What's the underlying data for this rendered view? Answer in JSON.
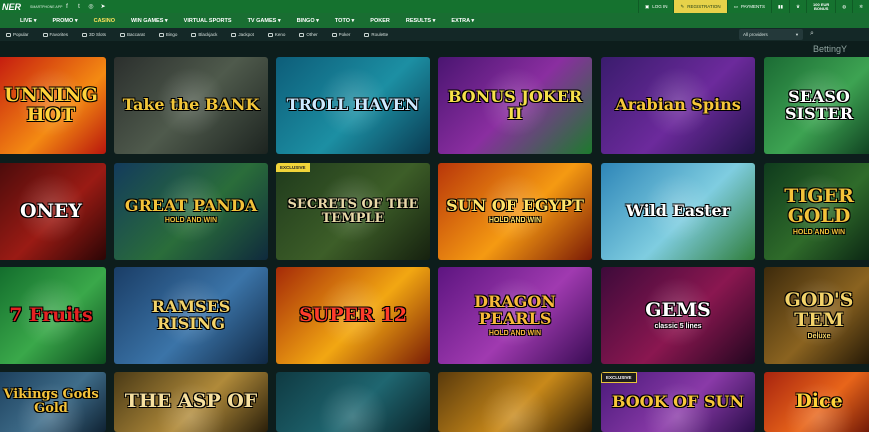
{
  "header": {
    "logo": "NER",
    "app_label": "SMARTPHONE APP",
    "social_icons": [
      "facebook-icon",
      "twitter-icon",
      "instagram-icon",
      "telegram-icon"
    ],
    "login": "LOG IN",
    "registration": "REGISTRATION",
    "payments": "PAYMENTS",
    "bonus_line1": "100 EUR",
    "bonus_line2": "BONUS"
  },
  "nav": {
    "items": [
      {
        "label": "LIVE ▾"
      },
      {
        "label": "PROMO ▾"
      },
      {
        "label": "CASINO"
      },
      {
        "label": "WIN GAMES ▾"
      },
      {
        "label": "VIRTUAL SPORTS"
      },
      {
        "label": "TV GAMES ▾"
      },
      {
        "label": "BINGO ▾"
      },
      {
        "label": "TOTO ▾"
      },
      {
        "label": "POKER"
      },
      {
        "label": "RESULTS ▾"
      },
      {
        "label": "EXTRA ▾"
      }
    ],
    "active": "CASINO"
  },
  "filters": {
    "items": [
      {
        "label": "Popular"
      },
      {
        "label": "Favorites"
      },
      {
        "label": "3D Slots"
      },
      {
        "label": "Baccarat"
      },
      {
        "label": "Bingo"
      },
      {
        "label": "Blackjack"
      },
      {
        "label": "Jackpot"
      },
      {
        "label": "Keno"
      },
      {
        "label": "Other"
      },
      {
        "label": "Poker"
      },
      {
        "label": "Roulette"
      }
    ],
    "providers": "All providers"
  },
  "watermark": "BettingY",
  "games": [
    {
      "title": "UNNING HOT",
      "sub": "",
      "badge": "",
      "bg": "linear-gradient(135deg,#c41a0f,#f48a12 60%,#b8160d)",
      "color": "#ffd23a"
    },
    {
      "title": "Take the BANK",
      "sub": "",
      "badge": "",
      "bg": "linear-gradient(135deg,#2b2f2d,#4f5a4c 50%,#1d2420)",
      "color": "#f2c63a"
    },
    {
      "title": "TROLL HAVEN",
      "sub": "",
      "badge": "",
      "bg": "linear-gradient(135deg,#0d5d79,#1c8fa3 55%,#0a3b52)",
      "color": "#cde9ff"
    },
    {
      "title": "BONUS JOKER II",
      "sub": "",
      "badge": "",
      "bg": "linear-gradient(135deg,#4a1571,#8a2ea0 50%,#1d7a2d)",
      "color": "#f6e04a"
    },
    {
      "title": "Arabian Spins",
      "sub": "",
      "badge": "",
      "bg": "linear-gradient(135deg,#3a1c6d,#6c2a9c 55%,#22134a)",
      "color": "#f7c63a"
    },
    {
      "title": "SEASO SISTER",
      "sub": "",
      "badge": "",
      "bg": "linear-gradient(135deg,#1b6b34,#3da352 55%,#0e3e1f)",
      "color": "#ffffff"
    },
    {
      "title": "ONEY",
      "sub": "",
      "badge": "",
      "bg": "linear-gradient(135deg,#4a0b0b,#9a1b14 55%,#2b0505)",
      "color": "#ffffff"
    },
    {
      "title": "GREAT PANDA",
      "sub": "HOLD AND WIN",
      "badge": "",
      "bg": "linear-gradient(135deg,#133b5c,#2a6d3a 55%,#0f2a3d)",
      "color": "#f3c23a"
    },
    {
      "title": "SECRETS OF THE TEMPLE",
      "sub": "",
      "badge": "EXCLUSIVE",
      "bg": "linear-gradient(135deg,#1f3a1c,#3d5e28 55%,#16210f)",
      "color": "#e9d9a8"
    },
    {
      "title": "SUN OF EGYPT",
      "sub": "HOLD AND WIN",
      "badge": "",
      "bg": "linear-gradient(135deg,#b8360a,#f59a12 55%,#7a1a06)",
      "color": "#ffe36a"
    },
    {
      "title": "Wild Easter",
      "sub": "",
      "badge": "",
      "bg": "linear-gradient(135deg,#2e86b8,#7fcde0 55%,#2f7d3a)",
      "color": "#ffffff"
    },
    {
      "title": "TIGER GOLD",
      "sub": "HOLD AND WIN",
      "badge": "",
      "bg": "linear-gradient(135deg,#0f3b1d,#2f6b2a 55%,#0a2413)",
      "color": "#f3c23a"
    },
    {
      "title": "7 Fruits",
      "sub": "",
      "badge": "",
      "bg": "linear-gradient(135deg,#126c2c,#3aa84a 55%,#0c4b1e)",
      "color": "#e52222"
    },
    {
      "title": "RAMSES RISING",
      "sub": "",
      "badge": "",
      "bg": "linear-gradient(135deg,#1a3d66,#3b74a8 55%,#102844)",
      "color": "#f3d36a"
    },
    {
      "title": "SUPER 12",
      "sub": "",
      "badge": "",
      "bg": "linear-gradient(135deg,#a52a08,#f2a712 55%,#7a1d06)",
      "color": "#ff3b2b"
    },
    {
      "title": "DRAGON PEARLS",
      "sub": "HOLD AND WIN",
      "badge": "",
      "bg": "linear-gradient(135deg,#5d1580,#a03ab0 55%,#3a0d55)",
      "color": "#f7b93a"
    },
    {
      "title": "GEMS",
      "sub": "classic 5 lines",
      "badge": "",
      "bg": "linear-gradient(135deg,#3d0a3a,#8a1750 55%,#22061f)",
      "color": "#ffffff"
    },
    {
      "title": "GOD'S TEM",
      "sub": "Deluxe",
      "badge": "",
      "bg": "linear-gradient(135deg,#3d2a0c,#8a6320 55%,#201505)",
      "color": "#f3d36a"
    },
    {
      "title": "Vikings Gods Gold",
      "sub": "",
      "badge": "",
      "bg": "linear-gradient(135deg,#1c3f5c,#3f6d8a 55%,#0f2233)",
      "color": "#f3c23a"
    },
    {
      "title": "THE ASP OF",
      "sub": "",
      "badge": "",
      "bg": "linear-gradient(135deg,#4a3a16,#b08a3a 55%,#2a1f0a)",
      "color": "#f6e0a0"
    },
    {
      "title": "",
      "sub": "",
      "badge": "",
      "bg": "linear-gradient(135deg,#0f3a42,#1f6670 55%,#0a2228)",
      "color": "#ffffff"
    },
    {
      "title": "",
      "sub": "",
      "badge": "",
      "bg": "linear-gradient(135deg,#5a3a0c,#c8891a 55%,#2f1c05)",
      "color": "#ffffff"
    },
    {
      "title": "BOOK OF SUN",
      "sub": "",
      "badge": "EXCLUSIVE",
      "bg": "linear-gradient(135deg,#4a1a7a,#8a3aa8 55%,#2a0d4a)",
      "color": "#f7c63a"
    },
    {
      "title": "Dice",
      "sub": "",
      "badge": "",
      "bg": "linear-gradient(135deg,#a8240f,#e8651a 55%,#6a1406)",
      "color": "#ffd23a"
    }
  ]
}
